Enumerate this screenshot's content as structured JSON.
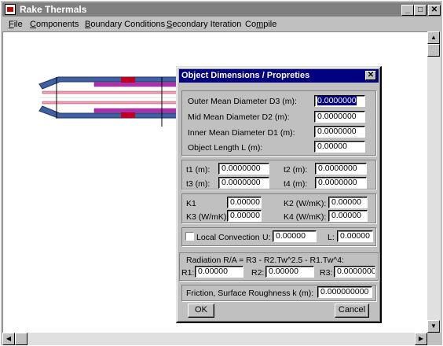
{
  "window": {
    "title": "Rake Thermals",
    "minimize_label": "_",
    "maximize_label": "□",
    "close_label": "✕"
  },
  "menu": {
    "file": {
      "hot": "F",
      "rest": "ile"
    },
    "components": {
      "hot": "C",
      "rest": "omponents"
    },
    "boundary": {
      "hot": "B",
      "rest": "oundary Conditions"
    },
    "secondary": {
      "hot": "S",
      "rest": "econdary Iteration"
    },
    "compile": {
      "pre": "Co",
      "hot": "m",
      "rest": "pile"
    }
  },
  "dialog": {
    "title": "Object Dimensions / Propreties",
    "close_label": "✕",
    "dims": {
      "outer_label": "Outer Mean Diameter D3 (m):",
      "outer_value": "0.0000000",
      "mid_label": "Mid Mean Diameter D2 (m):",
      "mid_value": "0.0000000",
      "inner_label": "Inner Mean Diameter D1 (m):",
      "inner_value": "0.0000000",
      "length_label": "Object Length L (m):",
      "length_value": "0.00000"
    },
    "thickness": {
      "t1_label": "t1 (m):",
      "t1_value": "0.0000000",
      "t2_label": "t2 (m):",
      "t2_value": "0.0000000",
      "t3_label": "t3 (m):",
      "t3_value": "0.0000000",
      "t4_label": "t4 (m):",
      "t4_value": "0.0000000"
    },
    "conductivity": {
      "k1_label": "K1",
      "k1_value": "0.00000",
      "k2_label": "K2 (W/mK):",
      "k2_value": "0.00000",
      "k3_label": "K3 (W/mK):",
      "k3_value": "0.00000",
      "k4_label": "K4 (W/mK):",
      "k4_value": "0.00000"
    },
    "convection": {
      "label": "Local Convection",
      "u_label": "U:",
      "u_value": "0.00000",
      "l_label": "L:",
      "l_value": "0.00000",
      "checked": false
    },
    "radiation": {
      "title": "Radiation R/A = R3 - R2.Tw^2.5 - R1.Tw^4:",
      "r1_label": "R1:",
      "r1_value": "0.00000",
      "r2_label": "R2:",
      "r2_value": "0.00000",
      "r3_label": "R3:",
      "r3_value": "0.0000000"
    },
    "friction": {
      "label": "Friction, Surface Roughness k (m):",
      "value": "0.000000000"
    },
    "ok_label": "OK",
    "cancel_label": "Cancel"
  },
  "colors": {
    "dialog_title": "#000080",
    "titlebar_inactive": "#808080",
    "pipe_blue": "#4060a0",
    "pipe_magenta": "#b030b0",
    "pipe_red": "#c00020",
    "pipe_pink": "#f0a0b0"
  },
  "icons": {
    "scroll_up": "▲",
    "scroll_down": "▼",
    "scroll_left": "◀",
    "scroll_right": "▶"
  }
}
